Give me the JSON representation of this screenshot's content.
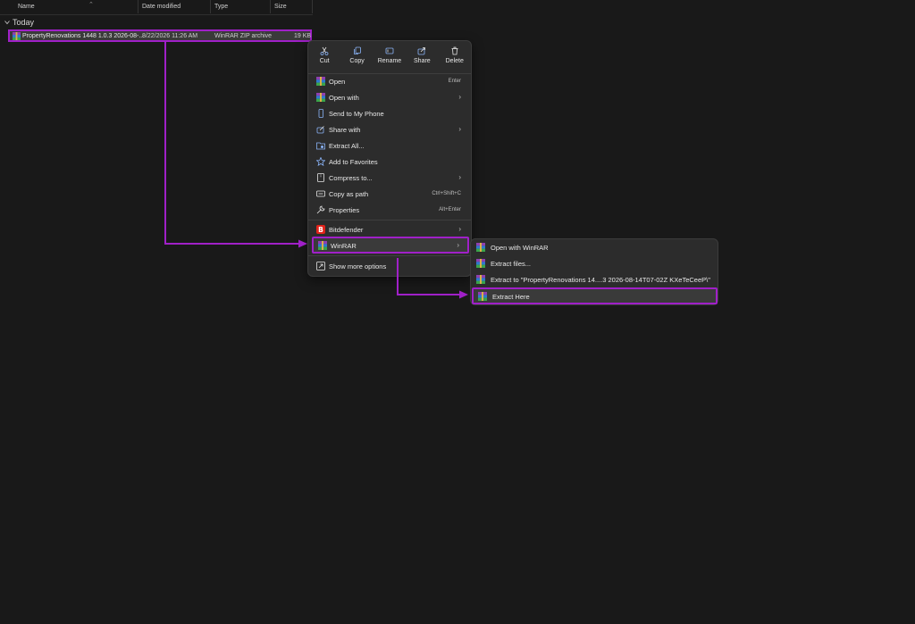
{
  "columns": {
    "name": "Name",
    "date_modified": "Date modified",
    "type": "Type",
    "size": "Size"
  },
  "group": {
    "label": "Today"
  },
  "file": {
    "name": "PropertyRenovations 1448 1.0.3 2026-08-...",
    "date": "8/22/2026 11:26 AM",
    "type": "WinRAR ZIP archive",
    "size": "19 KB",
    "icon": "winrar-archive-icon"
  },
  "context_menu": {
    "quick_actions": [
      {
        "label": "Cut",
        "icon": "scissors-icon"
      },
      {
        "label": "Copy",
        "icon": "copy-icon"
      },
      {
        "label": "Rename",
        "icon": "rename-icon"
      },
      {
        "label": "Share",
        "icon": "share-icon"
      },
      {
        "label": "Delete",
        "icon": "trash-icon"
      }
    ],
    "items": [
      {
        "label": "Open",
        "shortcut": "Enter",
        "icon": "winrar-icon"
      },
      {
        "label": "Open with",
        "icon": "winrar-icon"
      },
      {
        "label": "Send to My Phone",
        "icon": "phone-icon"
      },
      {
        "label": "Share with",
        "icon": "share-with-icon"
      },
      {
        "label": "Extract All...",
        "icon": "extract-folder-icon"
      },
      {
        "label": "Add to Favorites",
        "icon": "star-icon"
      },
      {
        "label": "Compress to...",
        "icon": "compress-icon"
      },
      {
        "label": "Copy as path",
        "shortcut": "Ctrl+Shift+C",
        "icon": "path-icon"
      },
      {
        "label": "Properties",
        "shortcut": "Alt+Enter",
        "icon": "wrench-icon"
      },
      {
        "label": "Bitdefender",
        "icon": "bitdefender-icon"
      },
      {
        "label": "WinRAR",
        "icon": "winrar-icon"
      },
      {
        "label": "Show more options",
        "icon": "more-options-icon"
      }
    ],
    "arrow_glyph": "›"
  },
  "winrar_submenu": {
    "items": [
      {
        "label": "Open with WinRAR"
      },
      {
        "label": "Extract files..."
      },
      {
        "label": "Extract to \"PropertyRenovations 14....3 2026-08-14T07-02Z KXeTeCeeP\\\""
      },
      {
        "label": "Extract Here"
      }
    ]
  },
  "colors": {
    "highlight": "#a020c8",
    "background": "#191919",
    "menu": "#2c2c2c",
    "bitdefender": "#e2231a"
  }
}
